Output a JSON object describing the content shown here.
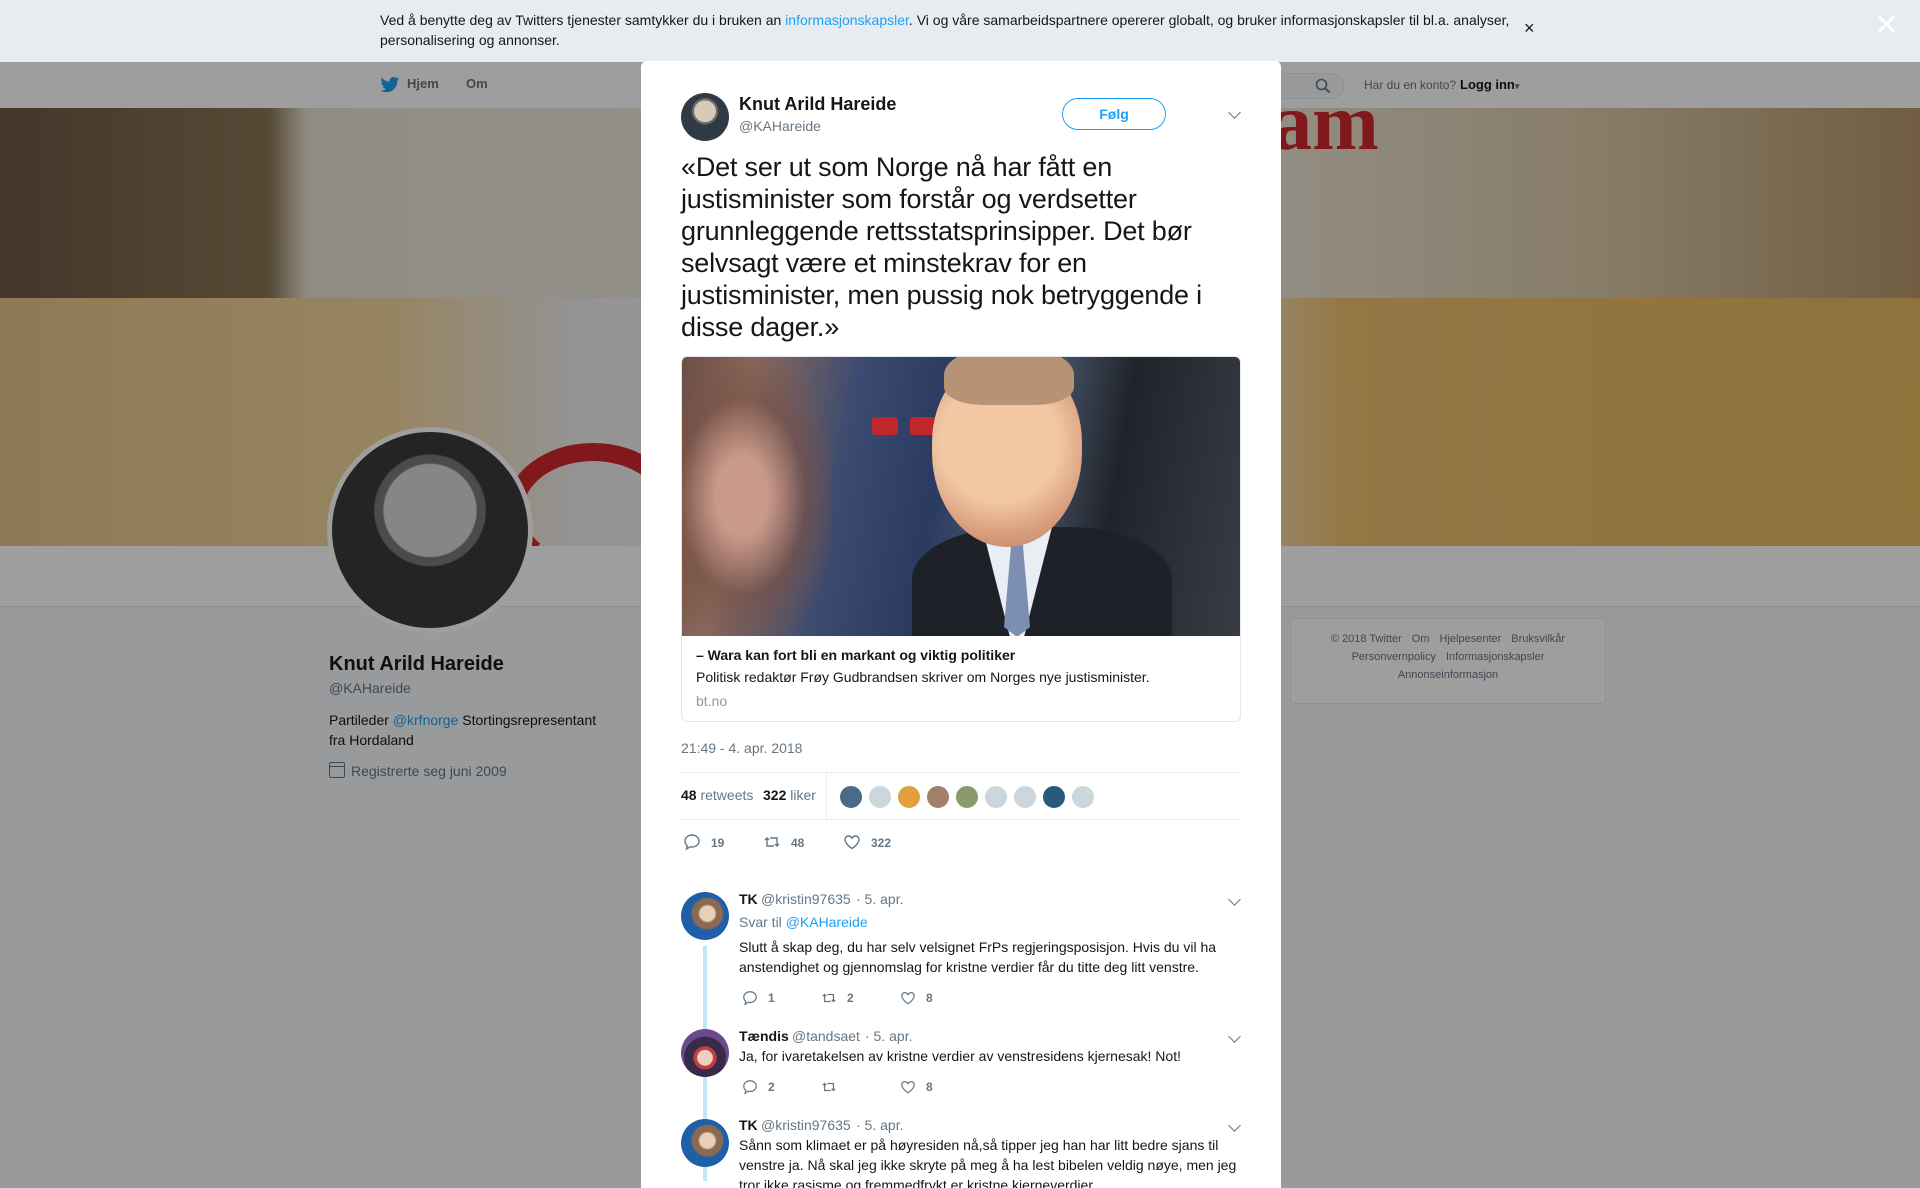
{
  "cookie_bar": {
    "text_before": "Ved å benytte deg av Twitters tjenester samtykker du i bruken an ",
    "link": "informasjonskapsler",
    "text_after": ". Vi og våre samarbeidspartnere opererer globalt, og bruker informasjonskapsler til bl.a. analyser, personalisering og annonser.",
    "close_symbol": "×"
  },
  "overlay": {
    "close_symbol": "✕"
  },
  "nav": {
    "home": "Hjem",
    "about": "Om",
    "login_question": "Har du en konto?",
    "login_link": "Logg inn",
    "login_caret": "▾"
  },
  "profile": {
    "name": "Knut Arild Hareide",
    "handle": "@KAHareide",
    "bio_prefix": "Partileder ",
    "bio_link": "@krfnorge",
    "bio_suffix": " Stortingsrepresentant fra Hordaland",
    "joined": "Registrerte seg juni 2009"
  },
  "footer": {
    "row1": [
      "© 2018 Twitter",
      "Om",
      "Hjelpesenter",
      "Bruksvilkår"
    ],
    "row2": [
      "Personvernpolicy",
      "Informasjonskapsler"
    ],
    "row3": [
      "Annonseinformasjon"
    ]
  },
  "tweet": {
    "author_name": "Knut Arild Hareide",
    "author_handle": "@KAHareide",
    "follow_label": "Følg",
    "text": "«Det ser ut som Norge nå har fått en justisminister som forstår og verdsetter grunnleggende rettsstatsprinsipper. Det bør selvsagt være et minstekrav for en justisminister, men pussig nok betryggende i disse dager.»",
    "card": {
      "title": "– Wara kan fort bli en markant og viktig politiker",
      "description": "Politisk redaktør Frøy Gudbrandsen skriver om Norges nye justisminister.",
      "domain": "bt.no"
    },
    "timestamp": "21:49 - 4. apr. 2018",
    "retweets_count": "48",
    "retweets_label": "retweets",
    "likes_count": "322",
    "likes_label": "liker",
    "likers": [
      {
        "name": "liker-1",
        "color": "#4a6a8a"
      },
      {
        "name": "liker-2",
        "color": "#ccd6dd"
      },
      {
        "name": "liker-3",
        "color": "#e0a040"
      },
      {
        "name": "liker-4",
        "color": "#a0806a"
      },
      {
        "name": "liker-5",
        "color": "#8a9a6a"
      },
      {
        "name": "liker-6",
        "color": "#ccd6dd"
      },
      {
        "name": "liker-7",
        "color": "#ccd6dd"
      },
      {
        "name": "liker-8",
        "color": "#2a5a7a"
      },
      {
        "name": "liker-9",
        "color": "#ccd6dd"
      }
    ],
    "actions": {
      "reply": "19",
      "retweet": "48",
      "like": "322"
    }
  },
  "replies": [
    {
      "name": "TK",
      "handle": "@kristin97635",
      "date": "· 5. apr.",
      "reply_to_label": "Svar til ",
      "reply_to_handle": "@KAHareide",
      "text": "Slutt å skap deg, du har selv velsignet FrPs regjeringsposisjon. Hvis du vil ha anstendighet og gjennomslag for kristne verdier får du titte deg litt venstre.",
      "reply_count": "1",
      "retweet_count": "2",
      "like_count": "8"
    },
    {
      "name": "Tændis",
      "handle": "@tandsaet",
      "date": "· 5. apr.",
      "text": "Ja, for ivaretakelsen av kristne verdier av venstresidens kjernesak! Not!",
      "reply_count": "2",
      "retweet_count": "",
      "like_count": "8"
    },
    {
      "name": "TK",
      "handle": "@kristin97635",
      "date": "· 5. apr.",
      "text": "Sånn som klimaet er på høyresiden nå,så tipper jeg han har litt bedre sjans til venstre ja. Nå skal jeg ikke skryte på meg å ha lest bibelen veldig nøye, men jeg tror ikke rasisme og fremmedfrykt er kristne kjerneverdier."
    }
  ],
  "colors": {
    "accent": "#1da1f2",
    "text": "#14171a",
    "muted": "#657786"
  }
}
